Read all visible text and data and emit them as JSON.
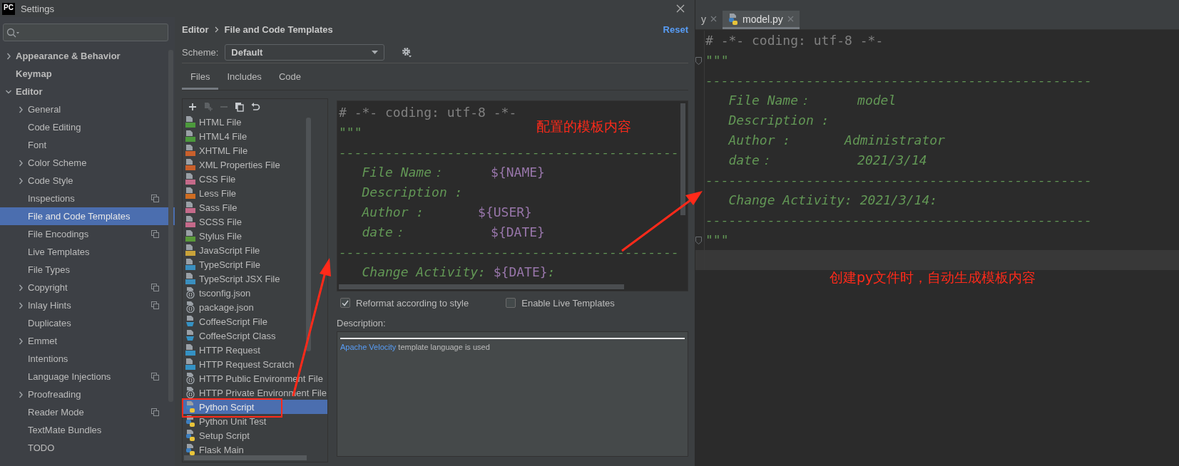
{
  "window": {
    "logo": "PC",
    "title": "Settings"
  },
  "sidebar": {
    "items": [
      {
        "label": "Appearance & Behavior",
        "expanded": false,
        "scoped": false,
        "selected": false
      },
      {
        "label": "Keymap",
        "scoped": false,
        "selected": false
      },
      {
        "label": "Editor",
        "expanded": true,
        "scoped": false,
        "selected": false,
        "children": [
          {
            "label": "General",
            "expanded": false,
            "scoped": false,
            "selected": false
          },
          {
            "label": "Code Editing",
            "scoped": false,
            "selected": false
          },
          {
            "label": "Font",
            "scoped": false,
            "selected": false
          },
          {
            "label": "Color Scheme",
            "expanded": false,
            "scoped": false,
            "selected": false
          },
          {
            "label": "Code Style",
            "expanded": false,
            "scoped": false,
            "selected": false
          },
          {
            "label": "Inspections",
            "scoped": true,
            "selected": false
          },
          {
            "label": "File and Code Templates",
            "scoped": false,
            "selected": true
          },
          {
            "label": "File Encodings",
            "scoped": true,
            "selected": false
          },
          {
            "label": "Live Templates",
            "scoped": false,
            "selected": false
          },
          {
            "label": "File Types",
            "scoped": false,
            "selected": false
          },
          {
            "label": "Copyright",
            "expanded": false,
            "scoped": true,
            "selected": false
          },
          {
            "label": "Inlay Hints",
            "expanded": false,
            "scoped": true,
            "selected": false
          },
          {
            "label": "Duplicates",
            "scoped": false,
            "selected": false
          },
          {
            "label": "Emmet",
            "expanded": false,
            "scoped": false,
            "selected": false
          },
          {
            "label": "Intentions",
            "scoped": false,
            "selected": false
          },
          {
            "label": "Language Injections",
            "scoped": true,
            "selected": false
          },
          {
            "label": "Proofreading",
            "expanded": false,
            "scoped": false,
            "selected": false
          },
          {
            "label": "Reader Mode",
            "scoped": true,
            "selected": false
          },
          {
            "label": "TextMate Bundles",
            "scoped": false,
            "selected": false
          },
          {
            "label": "TODO",
            "scoped": false,
            "selected": false
          }
        ]
      }
    ]
  },
  "header": {
    "breadcrumb": [
      "Editor",
      "File and Code Templates"
    ],
    "reset": "Reset"
  },
  "scheme": {
    "label": "Scheme:",
    "value": "Default"
  },
  "tabs": [
    {
      "label": "Files",
      "selected": true
    },
    {
      "label": "Includes",
      "selected": false
    },
    {
      "label": "Code",
      "selected": false
    }
  ],
  "toolbar": [
    {
      "kind": "add",
      "disabled": false
    },
    {
      "kind": "add-child",
      "disabled": true
    },
    {
      "kind": "remove",
      "disabled": true
    },
    {
      "kind": "copy",
      "disabled": false
    },
    {
      "kind": "reset",
      "disabled": false
    }
  ],
  "templates": [
    {
      "label": "HTML File",
      "kind": "file",
      "color": "#4c9a3c",
      "selected": false
    },
    {
      "label": "HTML4 File",
      "kind": "file",
      "color": "#4c9a3c",
      "selected": false
    },
    {
      "label": "XHTML File",
      "kind": "file",
      "color": "#c9602c",
      "selected": false
    },
    {
      "label": "XML Properties File",
      "kind": "file",
      "color": "#c9602c",
      "selected": false
    },
    {
      "label": "CSS File",
      "kind": "file",
      "color": "#c56a8a",
      "selected": false
    },
    {
      "label": "Less File",
      "kind": "file",
      "color": "#cf6d22",
      "selected": false
    },
    {
      "label": "Sass File",
      "kind": "file",
      "color": "#c56a8a",
      "selected": false
    },
    {
      "label": "SCSS File",
      "kind": "file",
      "color": "#c56a8a",
      "selected": false
    },
    {
      "label": "Stylus File",
      "kind": "file",
      "color": "#5a9a3a",
      "selected": false
    },
    {
      "label": "JavaScript File",
      "kind": "file",
      "color": "#c9a33a",
      "selected": false
    },
    {
      "label": "TypeScript File",
      "kind": "file",
      "color": "#3a8fbf",
      "selected": false
    },
    {
      "label": "TypeScript JSX File",
      "kind": "file",
      "color": "#3a8fbf",
      "selected": false
    },
    {
      "label": "tsconfig.json",
      "kind": "config",
      "selected": false
    },
    {
      "label": "package.json",
      "kind": "config",
      "selected": false
    },
    {
      "label": "CoffeeScript File",
      "kind": "coffee",
      "selected": false
    },
    {
      "label": "CoffeeScript Class",
      "kind": "coffee",
      "selected": false
    },
    {
      "label": "HTTP Request",
      "kind": "file",
      "color": "#3592c4",
      "selected": false
    },
    {
      "label": "HTTP Request Scratch",
      "kind": "file",
      "color": "#3592c4",
      "selected": false
    },
    {
      "label": "HTTP Public Environment File",
      "kind": "config",
      "selected": false
    },
    {
      "label": "HTTP Private Environment File",
      "kind": "config",
      "selected": false
    },
    {
      "label": "Python Script",
      "kind": "python",
      "selected": true
    },
    {
      "label": "Python Unit Test",
      "kind": "python",
      "selected": false
    },
    {
      "label": "Setup Script",
      "kind": "python",
      "selected": false
    },
    {
      "label": "Flask Main",
      "kind": "python",
      "selected": false
    }
  ],
  "template_editor": {
    "lines": [
      {
        "parts": [
          {
            "kind": "comment",
            "text": "# -*- coding: utf-8 -*-"
          }
        ]
      },
      {
        "parts": [
          {
            "kind": "doc",
            "text": "\"\"\""
          }
        ]
      },
      {
        "parts": [
          {
            "kind": "doc",
            "text": "--------------------------------------------"
          }
        ]
      },
      {
        "parts": [
          {
            "kind": "doc",
            "text": "   File Name：      "
          },
          {
            "kind": "var",
            "text": "${NAME}"
          }
        ]
      },
      {
        "parts": [
          {
            "kind": "doc",
            "text": "   Description :"
          }
        ]
      },
      {
        "parts": [
          {
            "kind": "doc",
            "text": "   Author :       "
          },
          {
            "kind": "var",
            "text": "${USER}"
          }
        ]
      },
      {
        "parts": [
          {
            "kind": "doc",
            "text": "   date：           "
          },
          {
            "kind": "var",
            "text": "${DATE}"
          }
        ]
      },
      {
        "parts": [
          {
            "kind": "doc",
            "text": "--------------------------------------------"
          }
        ]
      },
      {
        "parts": [
          {
            "kind": "doc",
            "text": "   Change Activity: "
          },
          {
            "kind": "var",
            "text": "${DATE}"
          },
          {
            "kind": "doc",
            "text": ":"
          }
        ]
      }
    ]
  },
  "options": [
    {
      "label": "Reformat according to style",
      "checked": true
    },
    {
      "label": "Enable Live Templates",
      "checked": false
    }
  ],
  "description": {
    "label": "Description:",
    "link": "Apache Velocity",
    "text": "template language is used"
  },
  "editor": {
    "tabs": [
      {
        "label": "y",
        "selected": false
      },
      {
        "label": "model.py",
        "selected": true
      }
    ],
    "lines": [
      {
        "fold": false,
        "current": false,
        "parts": [
          {
            "kind": "comment",
            "text": "# -*- coding: utf-8 -*-"
          }
        ]
      },
      {
        "fold": true,
        "current": false,
        "parts": [
          {
            "kind": "doc",
            "text": "\"\"\""
          }
        ]
      },
      {
        "fold": false,
        "current": false,
        "parts": [
          {
            "kind": "doc",
            "text": "--------------------------------------------------"
          }
        ]
      },
      {
        "fold": false,
        "current": false,
        "parts": [
          {
            "kind": "doc",
            "text": "   File Name：      model"
          }
        ]
      },
      {
        "fold": false,
        "current": false,
        "parts": [
          {
            "kind": "doc",
            "text": "   Description :"
          }
        ]
      },
      {
        "fold": false,
        "current": false,
        "parts": [
          {
            "kind": "doc",
            "text": "   Author :       Administrator"
          }
        ]
      },
      {
        "fold": false,
        "current": false,
        "parts": [
          {
            "kind": "doc",
            "text": "   date：           2021/3/14"
          }
        ]
      },
      {
        "fold": false,
        "current": false,
        "parts": [
          {
            "kind": "doc",
            "text": "--------------------------------------------------"
          }
        ]
      },
      {
        "fold": false,
        "current": false,
        "parts": [
          {
            "kind": "doc",
            "text": "   Change Activity: 2021/3/14:"
          }
        ]
      },
      {
        "fold": false,
        "current": false,
        "parts": [
          {
            "kind": "doc",
            "text": "--------------------------------------------------"
          }
        ]
      },
      {
        "fold": true,
        "current": false,
        "parts": [
          {
            "kind": "doc",
            "text": "\"\"\""
          }
        ]
      },
      {
        "fold": false,
        "current": true
      }
    ]
  },
  "annotations": [
    {
      "text": "配置的模板内容"
    },
    {
      "text": "创建py文件时，自动生成模板内容"
    }
  ]
}
